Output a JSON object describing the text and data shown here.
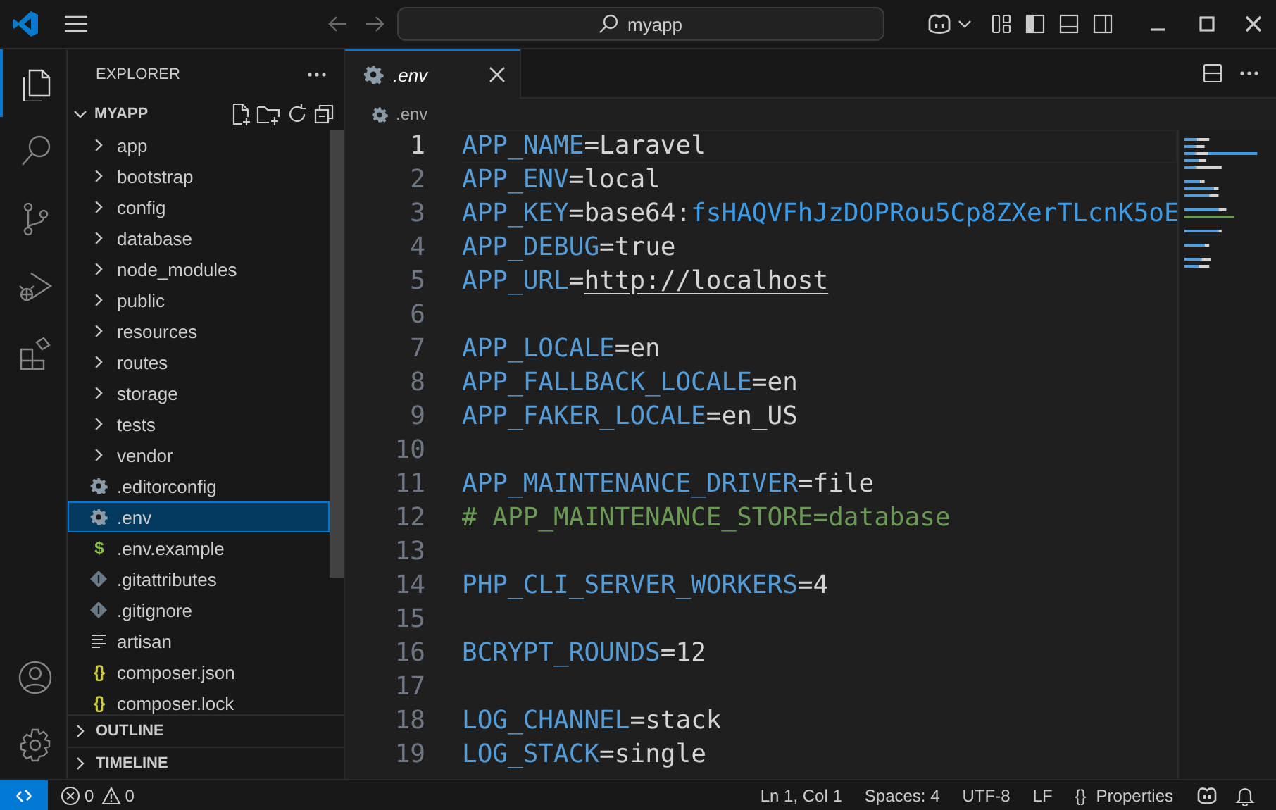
{
  "title_bar": {
    "search": "myapp"
  },
  "activity_bar": {
    "items": [
      {
        "kind": "explorer",
        "selected": true
      },
      {
        "kind": "search",
        "selected": false
      },
      {
        "kind": "source-control",
        "selected": false
      },
      {
        "kind": "run-debug",
        "selected": false
      },
      {
        "kind": "extensions",
        "selected": false
      }
    ],
    "bottom_items": [
      {
        "kind": "account",
        "selected": false
      },
      {
        "kind": "settings",
        "selected": false
      }
    ]
  },
  "sidebar": {
    "title": "EXPLORER",
    "folder": {
      "name": "MYAPP",
      "expanded": true,
      "items": [
        {
          "name": "app",
          "kind": "folder",
          "expanded": false,
          "selected": false
        },
        {
          "name": "bootstrap",
          "kind": "folder",
          "expanded": false,
          "selected": false
        },
        {
          "name": "config",
          "kind": "folder",
          "expanded": false,
          "selected": false
        },
        {
          "name": "database",
          "kind": "folder",
          "expanded": false,
          "selected": false
        },
        {
          "name": "node_modules",
          "kind": "folder",
          "expanded": false,
          "selected": false
        },
        {
          "name": "public",
          "kind": "folder",
          "expanded": false,
          "selected": false
        },
        {
          "name": "resources",
          "kind": "folder",
          "expanded": false,
          "selected": false
        },
        {
          "name": "routes",
          "kind": "folder",
          "expanded": false,
          "selected": false
        },
        {
          "name": "storage",
          "kind": "folder",
          "expanded": false,
          "selected": false
        },
        {
          "name": "tests",
          "kind": "folder",
          "expanded": false,
          "selected": false
        },
        {
          "name": "vendor",
          "kind": "folder",
          "expanded": false,
          "selected": false
        },
        {
          "name": ".editorconfig",
          "kind": "config",
          "selected": false
        },
        {
          "name": ".env",
          "kind": "config",
          "selected": true
        },
        {
          "name": ".env.example",
          "kind": "glyph",
          "icon_text": "$",
          "color": "#8dc149",
          "selected": false
        },
        {
          "name": ".gitattributes",
          "kind": "git",
          "selected": false
        },
        {
          "name": ".gitignore",
          "kind": "git",
          "selected": false
        },
        {
          "name": "artisan",
          "kind": "text",
          "selected": false
        },
        {
          "name": "composer.json",
          "kind": "glyph",
          "icon_text": "{}",
          "color": "#cbcb41",
          "selected": false
        },
        {
          "name": "composer.lock",
          "kind": "glyph",
          "icon_text": "{}",
          "color": "#cbcb41",
          "selected": false
        }
      ]
    },
    "sections": [
      {
        "name": "OUTLINE",
        "expanded": false
      },
      {
        "name": "TIMELINE",
        "expanded": false
      }
    ]
  },
  "editor": {
    "tabs": [
      {
        "label": ".env",
        "selected": true,
        "preview": true
      }
    ],
    "breadcrumb": [
      ".env"
    ],
    "lines": [
      {
        "number": "1",
        "current": true,
        "tokens": [
          {
            "text": "APP_NAME",
            "kind": "key"
          },
          {
            "text": "=",
            "kind": "operator"
          },
          {
            "text": "Laravel",
            "kind": "value"
          }
        ]
      },
      {
        "number": "2",
        "current": false,
        "tokens": [
          {
            "text": "APP_ENV",
            "kind": "key"
          },
          {
            "text": "=",
            "kind": "operator"
          },
          {
            "text": "local",
            "kind": "value"
          }
        ]
      },
      {
        "number": "3",
        "current": false,
        "tokens": [
          {
            "text": "APP_KEY",
            "kind": "key"
          },
          {
            "text": "=",
            "kind": "operator"
          },
          {
            "text": "base64:",
            "kind": "value"
          },
          {
            "text": "fsHAQVFhJzDOPRou5Cp8ZXerTLcnK5oE",
            "kind": "secret"
          }
        ]
      },
      {
        "number": "4",
        "current": false,
        "tokens": [
          {
            "text": "APP_DEBUG",
            "kind": "key"
          },
          {
            "text": "=",
            "kind": "operator"
          },
          {
            "text": "true",
            "kind": "value"
          }
        ]
      },
      {
        "number": "5",
        "current": false,
        "tokens": [
          {
            "text": "APP_URL",
            "kind": "key"
          },
          {
            "text": "=",
            "kind": "operator"
          },
          {
            "text": "http://localhost",
            "kind": "link"
          }
        ]
      },
      {
        "number": "6",
        "current": false
      },
      {
        "number": "7",
        "current": false,
        "tokens": [
          {
            "text": "APP_LOCALE",
            "kind": "key"
          },
          {
            "text": "=",
            "kind": "operator"
          },
          {
            "text": "en",
            "kind": "value"
          }
        ]
      },
      {
        "number": "8",
        "current": false,
        "tokens": [
          {
            "text": "APP_FALLBACK_LOCALE",
            "kind": "key"
          },
          {
            "text": "=",
            "kind": "operator"
          },
          {
            "text": "en",
            "kind": "value"
          }
        ]
      },
      {
        "number": "9",
        "current": false,
        "tokens": [
          {
            "text": "APP_FAKER_LOCALE",
            "kind": "key"
          },
          {
            "text": "=",
            "kind": "operator"
          },
          {
            "text": "en_US",
            "kind": "value"
          }
        ]
      },
      {
        "number": "10",
        "current": false
      },
      {
        "number": "11",
        "current": false,
        "tokens": [
          {
            "text": "APP_MAINTENANCE_DRIVER",
            "kind": "key"
          },
          {
            "text": "=",
            "kind": "operator"
          },
          {
            "text": "file",
            "kind": "value"
          }
        ]
      },
      {
        "number": "12",
        "current": false,
        "tokens": [
          {
            "text": "# APP_MAINTENANCE_STORE=database",
            "kind": "comment"
          }
        ]
      },
      {
        "number": "13",
        "current": false
      },
      {
        "number": "14",
        "current": false,
        "tokens": [
          {
            "text": "PHP_CLI_SERVER_WORKERS",
            "kind": "key"
          },
          {
            "text": "=",
            "kind": "operator"
          },
          {
            "text": "4",
            "kind": "value"
          }
        ]
      },
      {
        "number": "15",
        "current": false
      },
      {
        "number": "16",
        "current": false,
        "tokens": [
          {
            "text": "BCRYPT_ROUNDS",
            "kind": "key"
          },
          {
            "text": "=",
            "kind": "operator"
          },
          {
            "text": "12",
            "kind": "value"
          }
        ]
      },
      {
        "number": "17",
        "current": false
      },
      {
        "number": "18",
        "current": false,
        "tokens": [
          {
            "text": "LOG_CHANNEL",
            "kind": "key"
          },
          {
            "text": "=",
            "kind": "operator"
          },
          {
            "text": "stack",
            "kind": "value"
          }
        ]
      },
      {
        "number": "19",
        "current": false,
        "tokens": [
          {
            "text": "LOG_STACK",
            "kind": "key"
          },
          {
            "text": "=",
            "kind": "operator"
          },
          {
            "text": "single",
            "kind": "value"
          }
        ]
      }
    ]
  },
  "status_bar": {
    "errors": "0",
    "warnings": "0",
    "items": [
      "Ln 1, Col 1",
      "Spaces: 4",
      "UTF-8",
      "LF"
    ],
    "language": {
      "icon_text": "{}",
      "label": "Properties"
    }
  }
}
